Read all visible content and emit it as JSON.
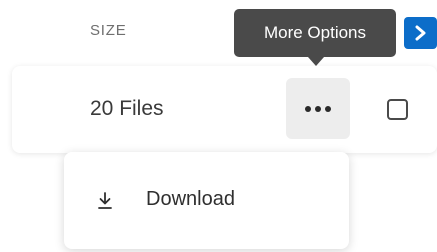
{
  "table": {
    "size_header": "SIZE"
  },
  "row": {
    "file_count": "20 Files"
  },
  "tooltip": {
    "text": "More Options"
  },
  "menu": {
    "items": [
      {
        "label": "Download",
        "icon": "download-icon"
      }
    ]
  },
  "icons": {
    "expand": "chevron-right-icon",
    "more": "more-horizontal-icon",
    "checkbox": "checkbox-unchecked"
  },
  "colors": {
    "accent": "#0c6dc9",
    "tooltip_bg": "#4a4a4a",
    "more_button_bg": "#ededed"
  }
}
